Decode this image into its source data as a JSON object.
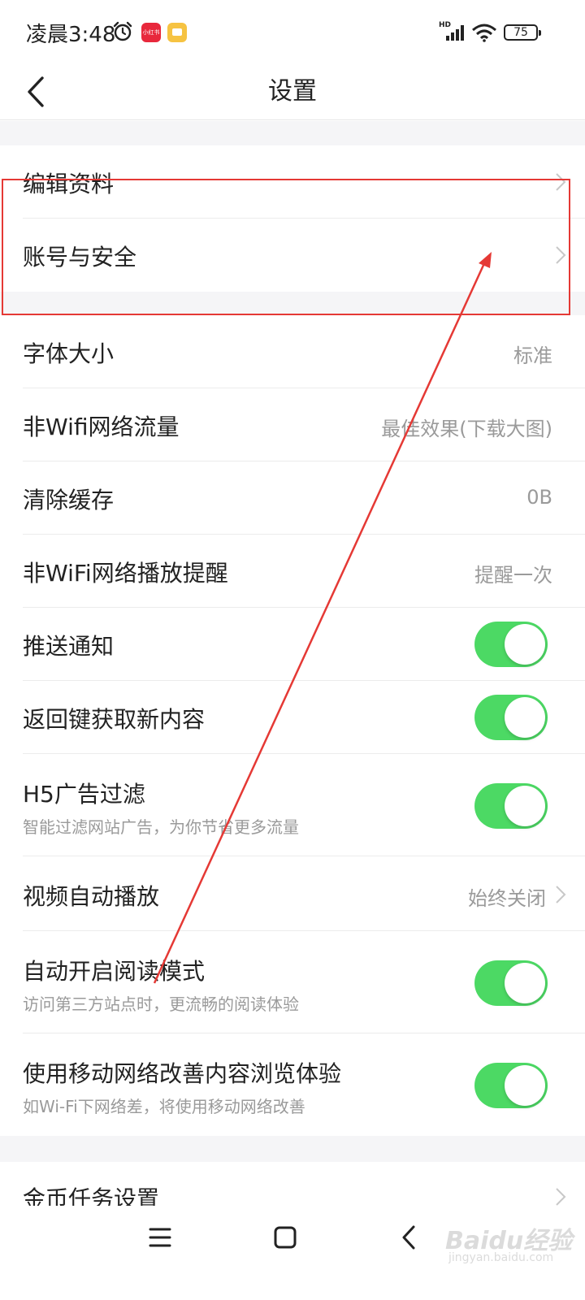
{
  "status_bar": {
    "time": "凌晨3:48",
    "app_icon_label": "小红书",
    "network_label": "HD",
    "battery": "75"
  },
  "header": {
    "title": "设置"
  },
  "sections": {
    "profile": [
      {
        "label": "编辑资料"
      },
      {
        "label": "账号与安全"
      }
    ],
    "general": {
      "font_size": {
        "label": "字体大小",
        "value": "标准"
      },
      "non_wifi_traffic": {
        "label": "非Wifi网络流量",
        "value": "最佳效果(下载大图)"
      },
      "clear_cache": {
        "label": "清除缓存",
        "value": "0B"
      },
      "non_wifi_play_reminder": {
        "label": "非WiFi网络播放提醒",
        "value": "提醒一次"
      },
      "push_notifications": {
        "label": "推送通知",
        "enabled": true
      },
      "back_key_refresh": {
        "label": "返回键获取新内容",
        "enabled": true
      },
      "h5_ad_filter": {
        "label": "H5广告过滤",
        "sublabel": "智能过滤网站广告，为你节省更多流量",
        "enabled": true
      },
      "video_autoplay": {
        "label": "视频自动播放",
        "value": "始终关闭"
      },
      "auto_reading_mode": {
        "label": "自动开启阅读模式",
        "sublabel": "访问第三方站点时，更流畅的阅读体验",
        "enabled": true
      },
      "mobile_network_boost": {
        "label": "使用移动网络改善内容浏览体验",
        "sublabel": "如Wi-Fi下网络差，将使用移动网络改善",
        "enabled": true
      }
    },
    "tasks": {
      "coin_task_settings": {
        "label": "金币任务设置"
      }
    }
  },
  "watermark": {
    "logo": "Baidu经验",
    "sub": "jingyan.baidu.com"
  },
  "colors": {
    "toggle_on": "#4cd964",
    "annotation": "#e53935",
    "secondary_text": "#9a9a9a",
    "section_gap": "#f5f5f7"
  }
}
